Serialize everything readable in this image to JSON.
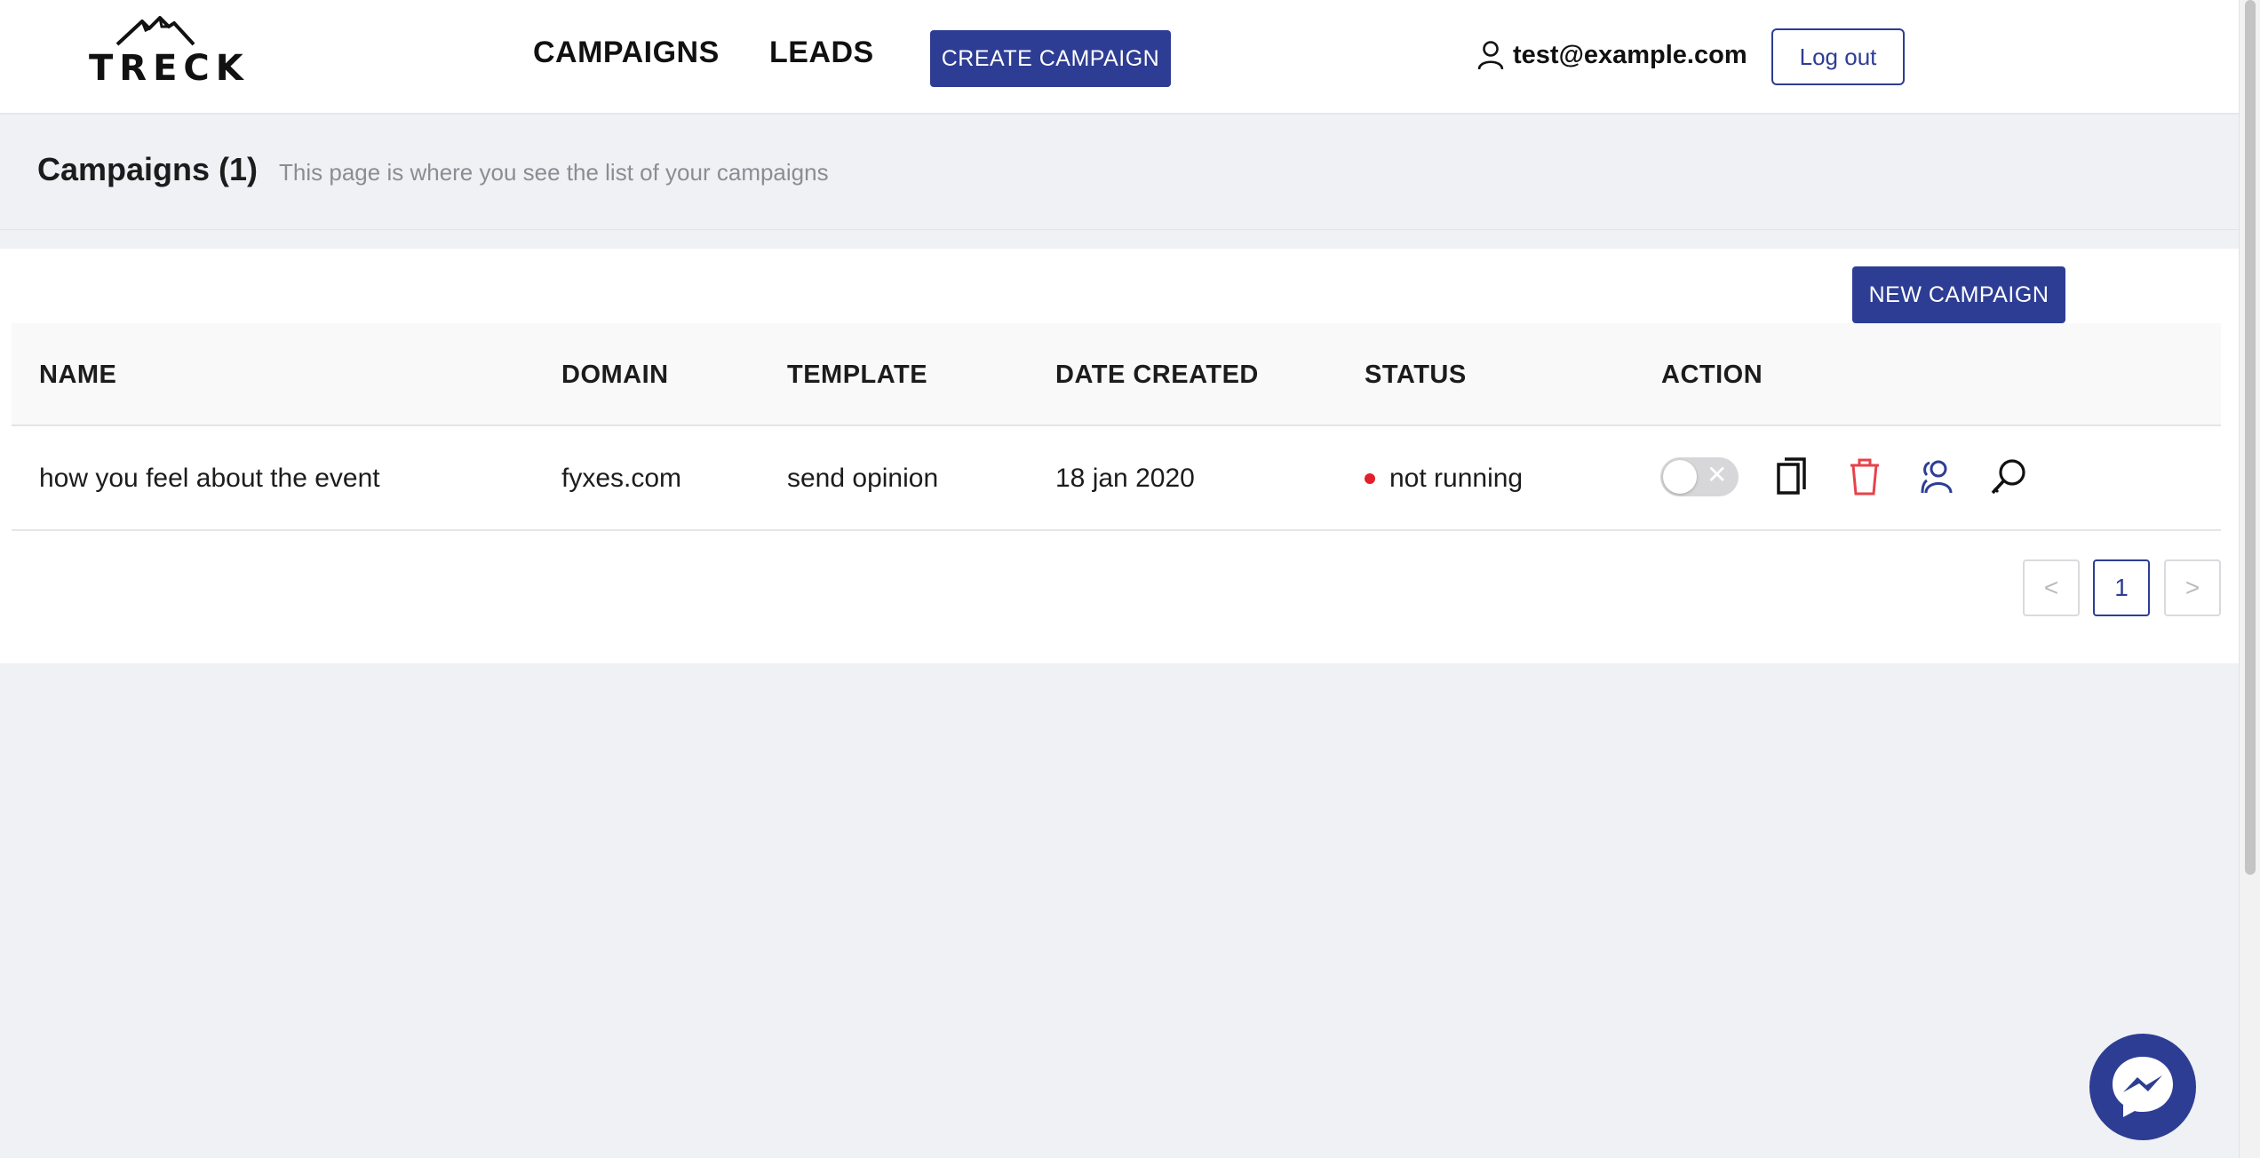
{
  "brand": {
    "name": "TRECK"
  },
  "nav": {
    "campaigns_label": "CAMPAIGNS",
    "leads_label": "LEADS",
    "create_campaign_label": "CREATE CAMPAIGN"
  },
  "user": {
    "email": "test@example.com",
    "logout_label": "Log out"
  },
  "page": {
    "title": "Campaigns (1)",
    "subtitle": "This page is where you see the list of your campaigns",
    "new_campaign_label": "NEW CAMPAIGN"
  },
  "table": {
    "columns": [
      "NAME",
      "DOMAIN",
      "TEMPLATE",
      "DATE CREATED",
      "STATUS",
      "ACTION"
    ],
    "rows": [
      {
        "name": "how you feel about the event",
        "domain": "fyxes.com",
        "template": "send opinion",
        "date_created": "18 jan 2020",
        "status": "not running",
        "running": false
      }
    ]
  },
  "pagination": {
    "prev": "<",
    "current": "1",
    "next": ">"
  },
  "icons": {
    "user": "user-icon",
    "copy": "copy-icon",
    "delete": "trash-icon",
    "leads": "users-icon",
    "inspect": "search-icon",
    "chat": "messenger-icon"
  },
  "colors": {
    "accent": "#2e3d94",
    "status_stopped": "#e0202a",
    "delete": "#e8424a",
    "background": "#f0f1f4"
  }
}
